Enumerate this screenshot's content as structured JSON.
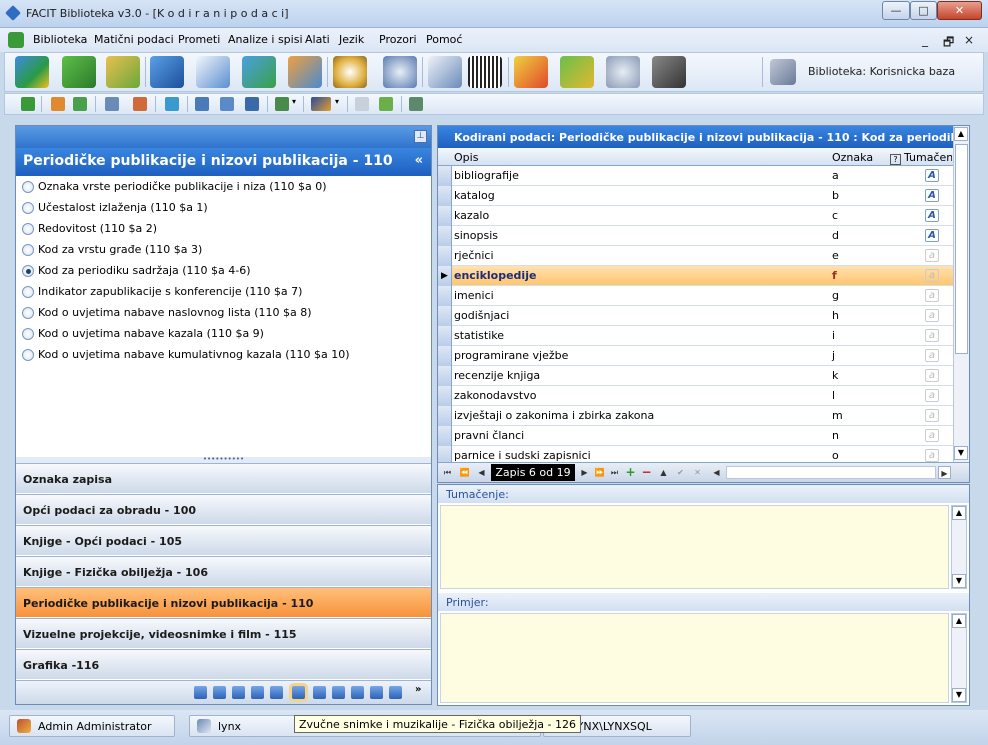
{
  "window": {
    "title": "FACIT Biblioteka v3.0 - [K o d i r a n i   p o d a c i]",
    "buttons": {
      "minimize": "—",
      "maximize": "□",
      "close": "✕"
    }
  },
  "menu": {
    "items": [
      "Biblioteka",
      "Matični podaci",
      "Prometi",
      "Analize i spisi",
      "Alati",
      "Jezik",
      "Prozori",
      "Pomoć"
    ],
    "mdi_controls": [
      "_",
      "🗗",
      "×"
    ]
  },
  "toolbar": {
    "database_label": "Biblioteka: Korisnicka baza",
    "icons": [
      "cubes-icon",
      "puzzle-icon",
      "shield-box-icon",
      "book-icon",
      "id-card-icon",
      "transfer-icon",
      "users-icon",
      "clock-icon",
      "person-search-icon",
      "cards-icon",
      "barcode-icon",
      "chart-icon",
      "money-icon",
      "gear-icon",
      "film-icon"
    ]
  },
  "left_pane": {
    "title": "Periodičke publikacije i nizovi publikacija - 110",
    "collapse_glyph": "«",
    "pin_glyph": "⊥",
    "options": [
      {
        "label": "Oznaka vrste periodičke publikacije i niza (110 $a 0)",
        "selected": false
      },
      {
        "label": "Učestalost izlaženja (110 $a 1)",
        "selected": false
      },
      {
        "label": "Redovitost (110 $a 2)",
        "selected": false
      },
      {
        "label": "Kod za vrstu građe (110 $a 3)",
        "selected": false
      },
      {
        "label": "Kod za periodiku sadržaja (110 $a 4-6)",
        "selected": true
      },
      {
        "label": "Indikator zapublikacije s konferencije (110 $a 7)",
        "selected": false
      },
      {
        "label": "Kod o uvjetima nabave naslovnog lista (110 $a 8)",
        "selected": false
      },
      {
        "label": "Kod o uvjetima nabave kazala (110 $a 9)",
        "selected": false
      },
      {
        "label": "Kod o uvjetima nabave kumulativnog kazala (110 $a 10)",
        "selected": false
      }
    ],
    "splitter_glyph": "••••••••••",
    "sections": [
      {
        "label": "Oznaka zapisa",
        "active": false
      },
      {
        "label": "Opći podaci za obradu - 100",
        "active": false
      },
      {
        "label": "Knjige - Opći podaci - 105",
        "active": false
      },
      {
        "label": "Knjige - Fizička obilježja - 106",
        "active": false
      },
      {
        "label": "Periodičke publikacije i nizovi publikacija - 110",
        "active": true
      },
      {
        "label": "Vizuelne projekcije, videosnimke i film - 115",
        "active": false
      },
      {
        "label": "Grafika -116",
        "active": false
      }
    ],
    "overflow_glyph": "»"
  },
  "grid": {
    "title": "Kodirani podaci: Periodičke publikacije i nizovi publikacija - 110 : Kod za periodiku sadržaja",
    "columns": {
      "opis": "Opis",
      "oznaka": "Oznaka",
      "tumacenje": "Tumačenje"
    },
    "rows": [
      {
        "opis": "bibliografije",
        "oznaka": "a",
        "has_tumacenje": true
      },
      {
        "opis": "katalog",
        "oznaka": "b",
        "has_tumacenje": true
      },
      {
        "opis": "kazalo",
        "oznaka": "c",
        "has_tumacenje": true
      },
      {
        "opis": "sinopsis",
        "oznaka": "d",
        "has_tumacenje": true
      },
      {
        "opis": "rječnici",
        "oznaka": "e",
        "has_tumacenje": false
      },
      {
        "opis": "enciklopedije",
        "oznaka": "f",
        "has_tumacenje": false,
        "selected": true
      },
      {
        "opis": "imenici",
        "oznaka": "g",
        "has_tumacenje": false
      },
      {
        "opis": "godišnjaci",
        "oznaka": "h",
        "has_tumacenje": false
      },
      {
        "opis": "statistike",
        "oznaka": "i",
        "has_tumacenje": false
      },
      {
        "opis": "programirane vježbe",
        "oznaka": "j",
        "has_tumacenje": false
      },
      {
        "opis": "recenzije knjiga",
        "oznaka": "k",
        "has_tumacenje": false
      },
      {
        "opis": "zakonodavstvo",
        "oznaka": "l",
        "has_tumacenje": false
      },
      {
        "opis": "izvještaji o zakonima i zbirka zakona",
        "oznaka": "m",
        "has_tumacenje": false
      },
      {
        "opis": "pravni članci",
        "oznaka": "n",
        "has_tumacenje": false
      },
      {
        "opis": "parnice i sudski zapisnici",
        "oznaka": "o",
        "has_tumacenje": false
      }
    ],
    "icon_glyph_filled": "A",
    "icon_glyph_empty": "a",
    "navigator": {
      "record_info": "Zapis 6 od 19",
      "glyphs": [
        "⏮",
        "⏪",
        "◀",
        "▶",
        "⏩",
        "⏭",
        "+",
        "−",
        "▲",
        "✔",
        "✕",
        "◀",
        "▶"
      ]
    }
  },
  "memo": {
    "tumacenje_label": "Tumačenje:",
    "primjer_label": "Primjer:"
  },
  "status": {
    "user": "Admin Administrator",
    "host": "lynx",
    "server": "LYNX\\LYNXSQL",
    "tooltip": "Zvučne snimke i muzikalije - Fizička obilježja - 126"
  },
  "colors": {
    "accent_blue": "#2f73cc",
    "active_orange": "#f7923a",
    "memo_yellow": "#fffde1"
  }
}
